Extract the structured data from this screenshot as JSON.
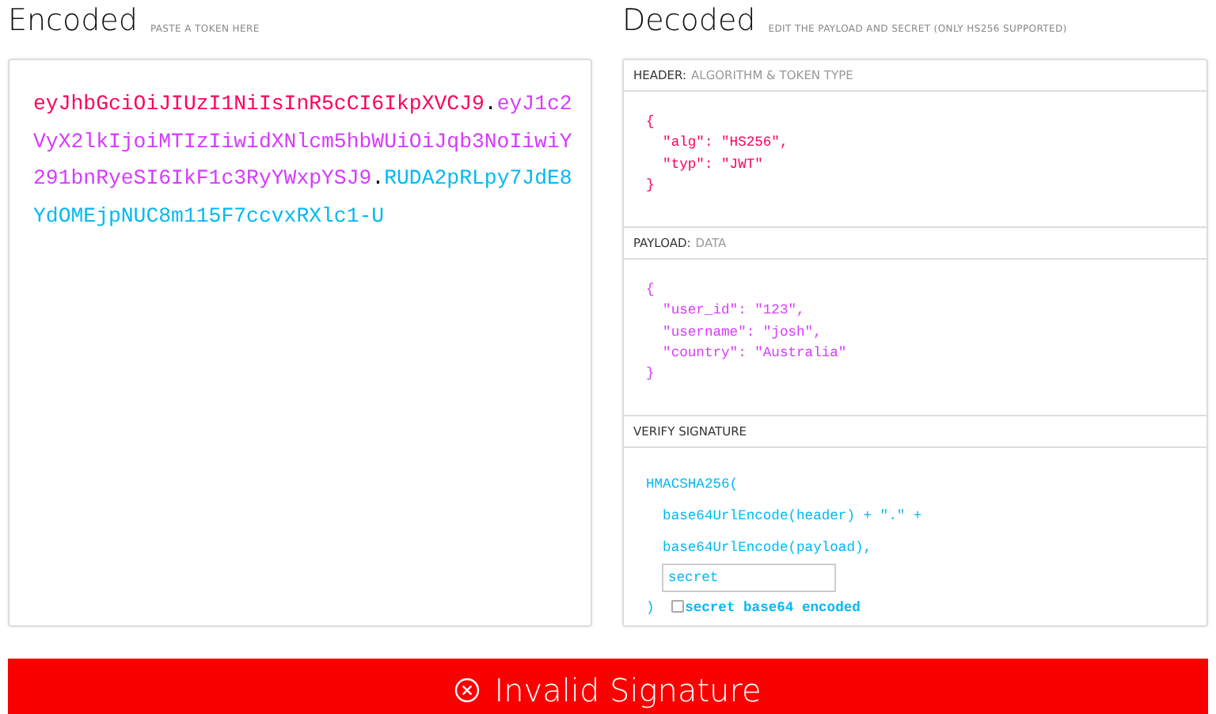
{
  "encoded": {
    "title": "Encoded",
    "hint": "PASTE A TOKEN HERE",
    "token": [
      {
        "text": "eyJhbGciOiJIUzI1NiIsInR5cCI6IkpXVCJ9",
        "color": "#fb015b"
      },
      {
        "text": ".",
        "color": "#000000"
      },
      {
        "text": "eyJ1c2VyX2lkIjoiMTIzIiwidXNlcm5hbWUiOiJqb3NoIiwiY291bnRyeSI6IkF1c3RyYWxpYSJ9",
        "color": "#d63aff"
      },
      {
        "text": ".",
        "color": "#000000"
      },
      {
        "text": "RUDA2pRLpy7JdE8YdOMEjpNUC8m115F7ccvxRXlc1-U",
        "color": "#00b9f1"
      }
    ]
  },
  "decoded": {
    "title": "Decoded",
    "hint": "EDIT THE PAYLOAD AND SECRET (ONLY HS256 SUPPORTED)",
    "sections": [
      {
        "kind": "code",
        "label": "HEADER:",
        "sublabel": "ALGORITHM & TOKEN TYPE",
        "color": "#fb015b",
        "lines": [
          "{",
          "  \"alg\": \"HS256\",",
          "  \"typ\": \"JWT\"",
          "}"
        ]
      },
      {
        "kind": "code",
        "label": "PAYLOAD:",
        "sublabel": "DATA",
        "color": "#d63aff",
        "lines": [
          "{",
          "  \"user_id\": \"123\",",
          "  \"username\": \"josh\",",
          "  \"country\": \"Australia\"",
          "}"
        ]
      },
      {
        "kind": "signature",
        "label": "VERIFY SIGNATURE",
        "color": "#00b9f1",
        "lines": [
          "HMACSHA256(",
          "  base64UrlEncode(header) + \".\" +",
          "  base64UrlEncode(payload),"
        ],
        "secret": "secret",
        "closing": ")",
        "checkbox": {
          "label": "secret base64 encoded",
          "checked": false
        }
      }
    ]
  },
  "status": {
    "text": "Invalid Signature",
    "valid": false
  }
}
